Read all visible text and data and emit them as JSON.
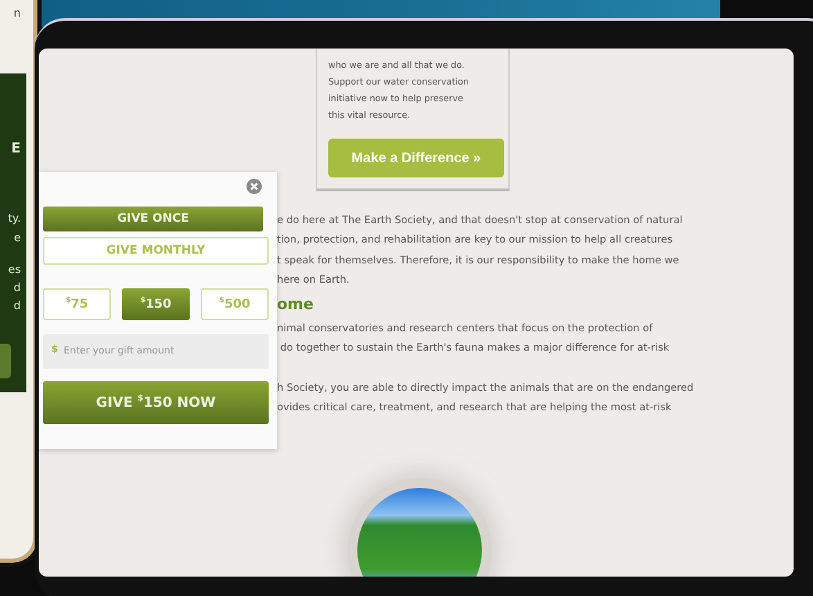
{
  "phone": {
    "fragments": [
      "n",
      "E",
      "ty.",
      "e",
      "es",
      "d",
      "d"
    ]
  },
  "info_card": {
    "text": "who we are and all that we do.\nSupport our water conservation\ninitiative now to help preserve\nthis vital resource.",
    "button": "Make a Difference »"
  },
  "donation_popup": {
    "frequency": [
      {
        "label": "GIVE ONCE",
        "selected": true
      },
      {
        "label": "GIVE MONTHLY",
        "selected": false
      }
    ],
    "amounts": [
      {
        "currency": "$",
        "amount": "75",
        "selected": false
      },
      {
        "currency": "$",
        "amount": "150",
        "selected": true
      },
      {
        "currency": "$",
        "amount": "500",
        "selected": false
      }
    ],
    "custom_amount": {
      "prefix": "$",
      "placeholder": "Enter your gift amount"
    },
    "submit": {
      "before": "GIVE",
      "currency": "$",
      "amount": "150",
      "after": "NOW"
    }
  },
  "article": {
    "paragraph_1": "e do here at The Earth Society, and that doesn't stop at conservation of natural\ntion, protection, and rehabilitation are key to our mission to help all creatures\nt speak for themselves. Therefore, it is our responsibility to make the home we\nhere on Earth.",
    "heading": "ome",
    "paragraph_2": "nimal conservatories and research centers that focus on the protection of\n do together to sustain the Earth's fauna makes a major difference for at-risk",
    "paragraph_3": "h Society, you are able to directly impact the animals that are on the endangered\novides critical care, treatment, and research that are helping the most at-risk"
  }
}
